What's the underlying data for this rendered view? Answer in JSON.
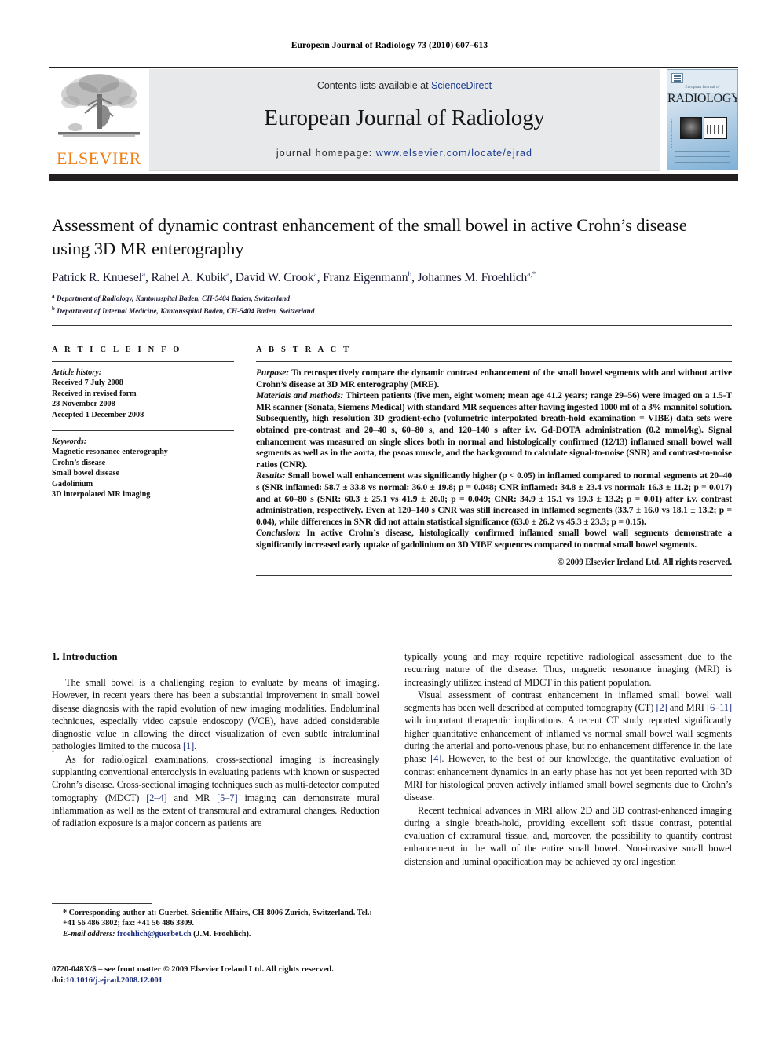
{
  "running_head": "European Journal of Radiology 73 (2010) 607–613",
  "masthead": {
    "contents_label": "Contents lists available at ",
    "sciencedirect": "ScienceDirect",
    "journal_name": "European Journal of Radiology",
    "homepage_label": "journal homepage: ",
    "homepage_url": "www.elsevier.com/locate/ejrad",
    "publisher_logo_text": "ELSEVIER",
    "cover": {
      "subtitle": "European Journal of",
      "title": "RADIOLOGY",
      "side_text": "www.elsevier.com"
    },
    "band_color": "#e8e9ea",
    "link_color": "#1a3a8f",
    "logo_color": "#f07f13"
  },
  "article": {
    "title": "Assessment of dynamic contrast enhancement of the small bowel in active Crohn’s disease using 3D MR enterography",
    "authors": "Patrick R. Knuesel<sup>a</sup>, Rahel A. Kubik<sup>a</sup>, David W. Crook<sup>a</sup>, Franz Eigenmann<sup>b</sup>, Johannes M. Froehlich<sup>a,*</sup>",
    "affiliations": [
      "<sup>a</sup> Department of Radiology, Kantonsspital Baden, CH-5404 Baden, Switzerland",
      "<sup>b</sup> Department of Internal Medicine, Kantonsspital Baden, CH-5404 Baden, Switzerland"
    ]
  },
  "article_info": {
    "heading": "A R T I C L E  I N F O",
    "history_label": "Article history:",
    "history": [
      "Received 7 July 2008",
      "Received in revised form",
      "28 November 2008",
      "Accepted 1 December 2008"
    ],
    "keywords_label": "Keywords:",
    "keywords": [
      "Magnetic resonance enterography",
      "Crohn’s disease",
      "Small bowel disease",
      "Gadolinium",
      "3D interpolated MR imaging"
    ]
  },
  "abstract": {
    "heading": "A B S T R A C T",
    "purpose_label": "Purpose:",
    "purpose": " To retrospectively compare the dynamic contrast enhancement of the small bowel segments with and without active Crohn’s disease at 3D MR enterography (MRE).",
    "methods_label": "Materials and methods:",
    "methods": " Thirteen patients (five men, eight women; mean age 41.2 years; range 29–56) were imaged on a 1.5-T MR scanner (Sonata, Siemens Medical) with standard MR sequences after having ingested 1000 ml of a 3% mannitol solution. Subsequently, high resolution 3D gradient-echo (volumetric interpolated breath-hold examination = VIBE) data sets were obtained pre-contrast and 20–40 s, 60–80 s, and 120–140 s after i.v. Gd-DOTA administration (0.2 mmol/kg). Signal enhancement was measured on single slices both in normal and histologically confirmed (12/13) inflamed small bowel wall segments as well as in the aorta, the psoas muscle, and the background to calculate signal-to-noise (SNR) and contrast-to-noise ratios (CNR).",
    "results_label": "Results:",
    "results": " Small bowel wall enhancement was significantly higher (p < 0.05) in inflamed compared to normal segments at 20–40 s (SNR inflamed: 58.7 ± 33.8 vs normal: 36.0 ± 19.8; p = 0.048; CNR inflamed: 34.8 ± 23.4 vs normal: 16.3 ± 11.2; p = 0.017) and at 60–80 s (SNR: 60.3 ± 25.1 vs 41.9 ± 20.0; p = 0.049; CNR: 34.9 ± 15.1 vs 19.3 ± 13.2; p = 0.01) after i.v. contrast administration, respectively. Even at 120–140 s CNR was still increased in inflamed segments (33.7 ± 16.0 vs 18.1 ± 13.2; p = 0.04), while differences in SNR did not attain statistical significance (63.0 ± 26.2 vs 45.3 ± 23.3; p = 0.15).",
    "conclusion_label": "Conclusion:",
    "conclusion": " In active Crohn’s disease, histologically confirmed inflamed small bowel wall segments demonstrate a significantly increased early uptake of gadolinium on 3D VIBE sequences compared to normal small bowel segments.",
    "copyright": "© 2009 Elsevier Ireland Ltd. All rights reserved."
  },
  "body": {
    "section_heading": "1. Introduction",
    "left_paragraphs": [
      "The small bowel is a challenging region to evaluate by means of imaging. However, in recent years there has been a substantial improvement in small bowel disease diagnosis with the rapid evolution of new imaging modalities. Endoluminal techniques, especially video capsule endoscopy (VCE), have added considerable diagnostic value in allowing the direct visualization of even subtle intraluminal pathologies limited to the mucosa <span class=\"ref\">[1]</span>.",
      "As for radiological examinations, cross-sectional imaging is increasingly supplanting conventional enteroclysis in evaluating patients with known or suspected Crohn’s disease. Cross-sectional imaging techniques such as multi-detector computed tomography (MDCT) <span class=\"ref\">[2–4]</span> and MR <span class=\"ref\">[5–7]</span> imaging can demonstrate mural inflammation as well as the extent of transmural and extramural changes. Reduction of radiation exposure is a major concern as patients are"
    ],
    "right_paragraphs": [
      "typically young and may require repetitive radiological assessment due to the recurring nature of the disease. Thus, magnetic resonance imaging (MRI) is increasingly utilized instead of MDCT in this patient population.",
      "Visual assessment of contrast enhancement in inflamed small bowel wall segments has been well described at computed tomography (CT) <span class=\"ref\">[2]</span> and MRI <span class=\"ref\">[6–11]</span> with important therapeutic implications. A recent CT study reported significantly higher quantitative enhancement of inflamed vs normal small bowel wall segments during the arterial and porto-venous phase, but no enhancement difference in the late phase <span class=\"ref\">[4]</span>. However, to the best of our knowledge, the quantitative evaluation of contrast enhancement dynamics in an early phase has not yet been reported with 3D MRI for histological proven actively inflamed small bowel segments due to Crohn’s disease.",
      "Recent technical advances in MRI allow 2D and 3D contrast-enhanced imaging during a single breath-hold, providing excellent soft tissue contrast, potential evaluation of extramural tissue, and, moreover, the possibility to quantify contrast enhancement in the wall of the entire small bowel. Non-invasive small bowel distension and luminal opacification may be achieved by oral ingestion"
    ]
  },
  "footnotes": {
    "corresponding": "* Corresponding author at: Guerbet, Scientific Affairs, CH-8006 Zurich, Switzerland. Tel.: +41 56 486 3802; fax: +41 56 486 3809.",
    "email_label": "E-mail address:",
    "email": "froehlich@guerbet.ch",
    "email_owner": " (J.M. Froehlich).",
    "issn_line": "0720-048X/$ – see front matter © 2009 Elsevier Ireland Ltd. All rights reserved.",
    "doi_label": "doi:",
    "doi": "10.1016/j.ejrad.2008.12.001"
  }
}
